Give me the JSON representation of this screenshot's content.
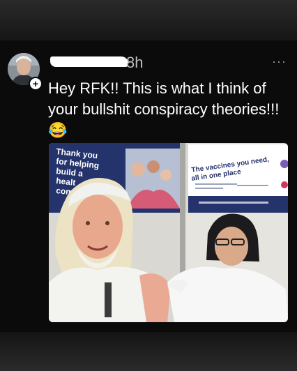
{
  "post": {
    "timestamp": "8h",
    "caption": "Hey RFK!! This is what I think of your bullshit conspiracy theories!!! 😂",
    "follow_symbol": "+",
    "more_symbol": "···"
  },
  "banner_left": {
    "lines": [
      "Thank you",
      "for helping",
      "build a",
      "healt",
      "com"
    ]
  },
  "banner_right": {
    "title": [
      "The vaccines you need,",
      "all in one place"
    ]
  },
  "colors": {
    "background": "#0b0b0b",
    "text": "#ffffff",
    "timestamp": "#bdbdbd",
    "banner_navy": "#24336b"
  },
  "icons": {
    "follow": "plus-icon",
    "more": "more-options-icon"
  }
}
